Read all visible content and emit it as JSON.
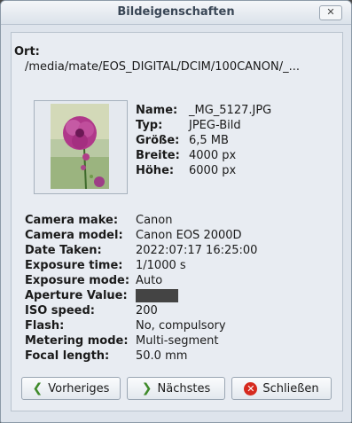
{
  "window": {
    "title": "Bildeigenschaften",
    "close_glyph": "✕"
  },
  "ort": {
    "label": "Ort:",
    "path": "/media/mate/EOS_DIGITAL/DCIM/100CANON/_..."
  },
  "file_info": [
    {
      "key": "Name:",
      "value": "_MG_5127.JPG"
    },
    {
      "key": "Typ:",
      "value": "JPEG-Bild"
    },
    {
      "key": "Größe:",
      "value": "6,5 MB"
    },
    {
      "key": "Breite:",
      "value": "4000 px"
    },
    {
      "key": "Höhe:",
      "value": "6000 px"
    }
  ],
  "exif": [
    {
      "key": "Camera make:",
      "value": "Canon"
    },
    {
      "key": "Camera model:",
      "value": "Canon EOS 2000D"
    },
    {
      "key": "Date Taken:",
      "value": "2022:07:17 16:25:00"
    },
    {
      "key": "Exposure time:",
      "value": "1/1000 s"
    },
    {
      "key": "Exposure mode:",
      "value": "Auto"
    },
    {
      "key": "Aperture Value:",
      "value": "",
      "redacted": true
    },
    {
      "key": "ISO speed:",
      "value": "200"
    },
    {
      "key": "Flash:",
      "value": "No, compulsory"
    },
    {
      "key": "Metering mode:",
      "value": "Multi-segment"
    },
    {
      "key": "Focal length:",
      "value": "50.0 mm"
    }
  ],
  "buttons": {
    "prev": {
      "label": "Vorheriges",
      "icon": "arrow-left-icon"
    },
    "next": {
      "label": "Nächstes",
      "icon": "arrow-right-icon"
    },
    "close": {
      "label": "Schließen",
      "icon": "close-circle-icon"
    }
  }
}
